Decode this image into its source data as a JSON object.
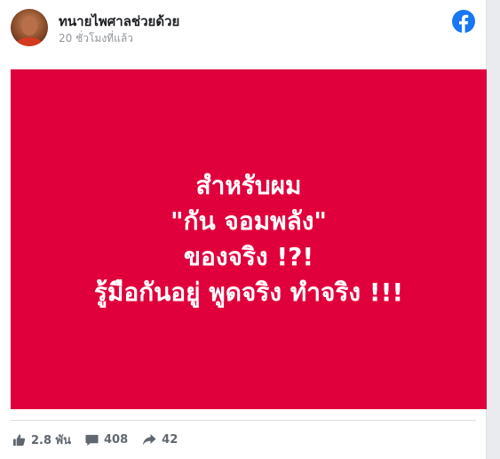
{
  "post": {
    "page_name": "ทนายไพศาลช่วยด้วย",
    "timestamp": "20 ชั่วโมงที่แล้ว",
    "image_bg_color": "#e0003c",
    "image_lines": [
      "สำหรับผม",
      "\"กัน จอมพลัง\"",
      "ของจริง !?!",
      "รู้มือกันอยู่ พูดจริง ทำจริง !!!"
    ]
  },
  "footer": {
    "likes": "2.8 พัน",
    "comments": "408",
    "shares": "42"
  },
  "icons": {
    "brand": "facebook-icon",
    "like": "thumbs-up-icon",
    "comment": "comment-icon",
    "share": "share-icon"
  },
  "colors": {
    "facebook_blue": "#1877f2",
    "secondary_text": "#606770"
  }
}
